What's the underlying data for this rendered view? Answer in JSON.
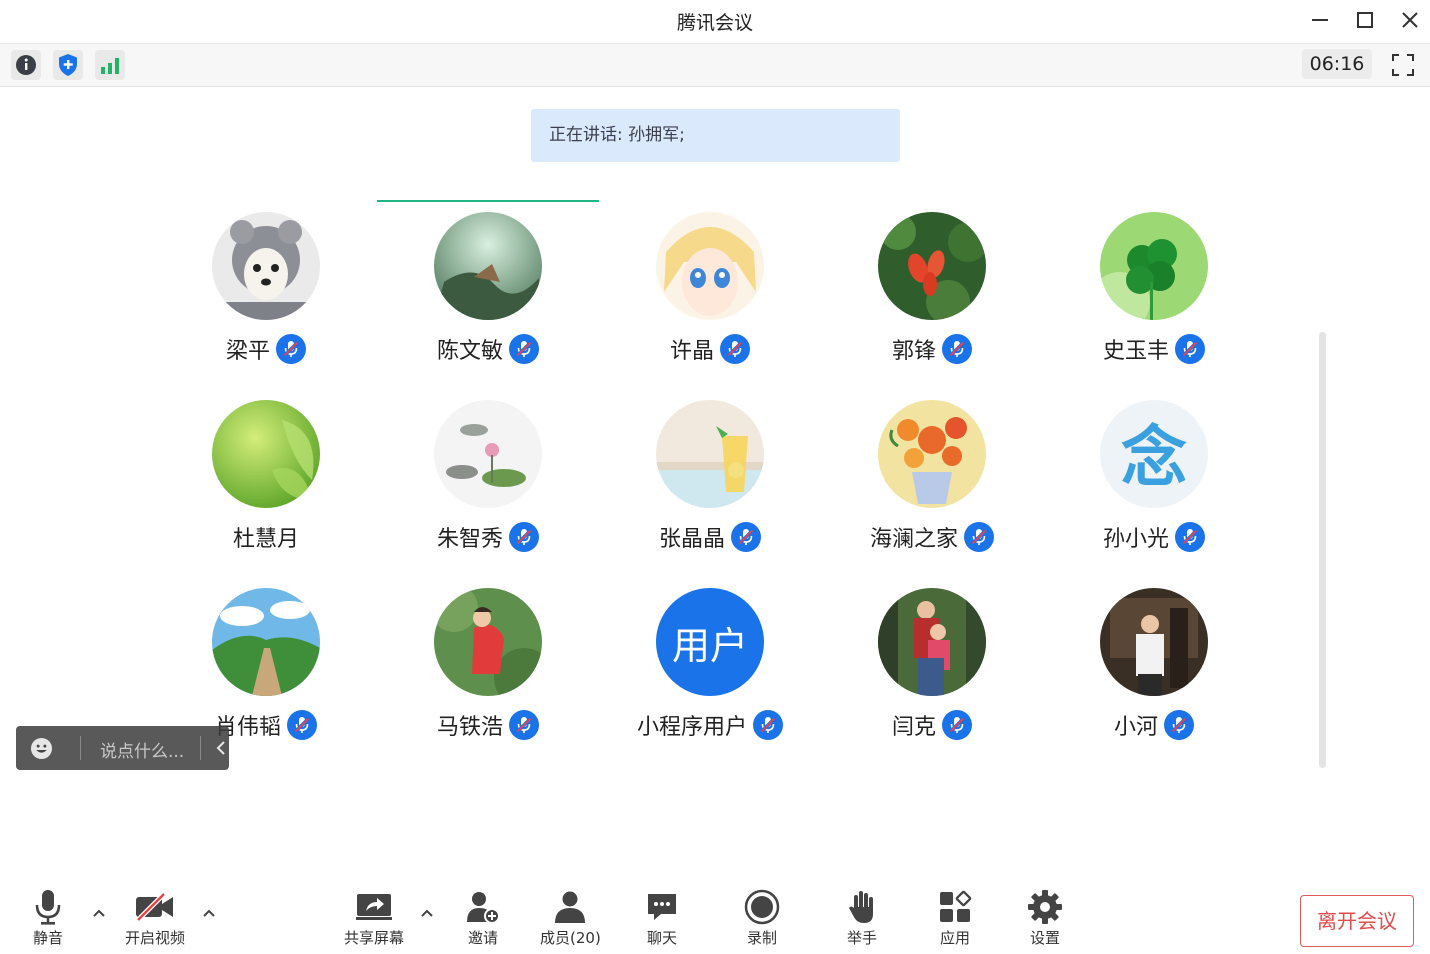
{
  "window": {
    "title": "腾讯会议"
  },
  "top_toolbar": {
    "timer": "06:16"
  },
  "speaking": {
    "text": "正在讲话: 孙拥军;"
  },
  "participants": [
    {
      "name": "梁平",
      "mic": true
    },
    {
      "name": "陈文敏",
      "mic": true
    },
    {
      "name": "许晶",
      "mic": true
    },
    {
      "name": "郭锋",
      "mic": true
    },
    {
      "name": "史玉丰",
      "mic": true
    },
    {
      "name": "杜慧月",
      "mic": false
    },
    {
      "name": "朱智秀",
      "mic": true
    },
    {
      "name": "张晶晶",
      "mic": true
    },
    {
      "name": "海澜之家",
      "mic": true
    },
    {
      "name": "孙小光",
      "mic": true
    },
    {
      "name": "肖伟韬",
      "mic": true
    },
    {
      "name": "马铁浩",
      "mic": true
    },
    {
      "name": "小程序用户",
      "mic": true,
      "avatar_text": "用户"
    },
    {
      "name": "闫克",
      "mic": true
    },
    {
      "name": "小河",
      "mic": true
    }
  ],
  "chat_input": {
    "placeholder": "说点什么..."
  },
  "bottom_toolbar": {
    "mute": "静音",
    "video": "开启视频",
    "share": "共享屏幕",
    "invite": "邀请",
    "members": "成员(20)",
    "chat": "聊天",
    "record": "录制",
    "raise_hand": "举手",
    "apps": "应用",
    "settings": "设置",
    "leave": "离开会议"
  },
  "colors": {
    "accent": "#1a73e8",
    "leave": "#e14b4b",
    "speaking_bg": "#dbe9fc",
    "indicator": "#1db882"
  }
}
